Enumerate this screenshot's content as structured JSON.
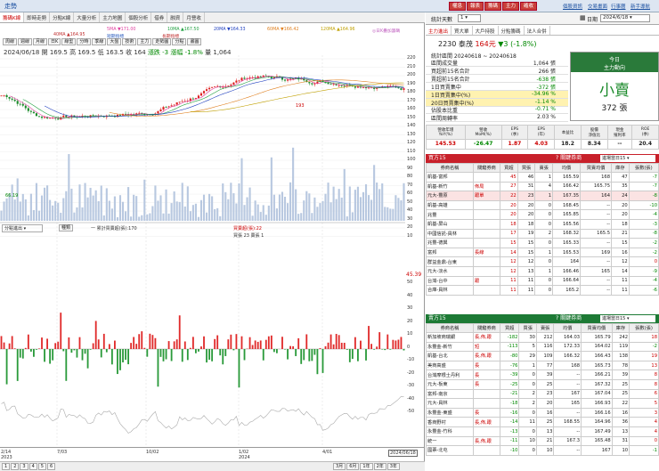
{
  "app": {
    "title": "走勢",
    "buttons": [
      "權息",
      "報表",
      "籌碼",
      "主力",
      "確收"
    ],
    "links": [
      "個股資訊",
      "交易畫面",
      "行事曆",
      "新手導航"
    ]
  },
  "tabs": [
    "籌碼K線",
    "即時走勢",
    "分點K線",
    "大量分析",
    "主力地圖",
    "個股分析",
    "借券",
    "融資",
    "月營收"
  ],
  "ma": {
    "line1": [
      {
        "t": "5MA ▼171.00",
        "c": "#e040a0"
      },
      {
        "t": "10MA ▲167.50",
        "c": "#20a040"
      },
      {
        "t": "20MA ▼164.33",
        "c": "#2040c0"
      },
      {
        "t": "60MA ▼166.42",
        "c": "#e08020"
      },
      {
        "t": "120MA ▲164.96",
        "c": "#c0a000"
      },
      {
        "t": "◎日K疊加籌碼",
        "c": "#c060c0"
      }
    ],
    "line2": [
      {
        "t": "40MA ▲164.95",
        "c": "#c03030"
      },
      {
        "t": "短期指標",
        "c": "#3060c0"
      },
      {
        "t": "長期指標",
        "c": "#c03030"
      }
    ]
  },
  "toolbar": [
    "周線",
    "週線",
    "月線",
    "日K",
    "線型",
    "分時",
    "季線",
    "大盤",
    "技術",
    "主力",
    "走勢圖",
    "分點",
    "畫圖"
  ],
  "info": {
    "date": "2024/06/18",
    "open": "開 169.5",
    "high": "高 169.5",
    "low": "低 163.5",
    "close": "收 164",
    "chg": "漲跌 -3",
    "pct": "漲幅 -1.8%",
    "vol": "量 1,064"
  },
  "yaxis": [
    "220",
    "210",
    "200",
    "190",
    "180",
    "170",
    "160",
    "150",
    "140",
    "130",
    "120",
    "110",
    "100",
    "90",
    "80",
    "70",
    "60",
    "50",
    "40",
    "30",
    "20",
    "10"
  ],
  "price_annot": {
    "hi": "193",
    "lo": "66.19"
  },
  "sub": {
    "select": "分點進出",
    "btn": "種類",
    "legend1": "一 累計買賣超(張):170",
    "legend2": "買賣超(張):22",
    "legend3": "買張 23  賣張 1",
    "last": "45.39",
    "ticks": [
      "50",
      "40",
      "30",
      "20",
      "10",
      "0",
      "-10",
      "-20",
      "-30",
      "-40",
      "-50"
    ]
  },
  "xaxis": [
    "2/14",
    "7/03",
    "10/02",
    "1/02",
    "4/01",
    "2024/06/18"
  ],
  "xaxis_years": [
    "2023",
    "2024"
  ],
  "bottom": {
    "pages": [
      "1",
      "2",
      "3",
      "4",
      "5",
      "6"
    ],
    "ranges": [
      "3月",
      "6月",
      "1年",
      "2年",
      "3年"
    ]
  },
  "right": {
    "header": {
      "label": "統計天數",
      "days": "1",
      "date_label": "日期",
      "date": "2024/6/18"
    },
    "subtabs": [
      "主力進出",
      "買大單",
      "大戶持股",
      "分點籌碼",
      "法人合併"
    ],
    "stock": {
      "code": "2230 泰茂",
      "price": "164元",
      "chg": "▼3 (-1.8%)"
    },
    "range": "統計區間  20240618 ~ 20240618",
    "stats": [
      {
        "k": "區間成交量",
        "v": "1,064 張"
      },
      {
        "k": "買超前15名合計",
        "v": "266 張"
      },
      {
        "k": "賣超前15名合計",
        "v": "-638 張"
      },
      {
        "k": "1日買賣集中",
        "v": "-372 張"
      },
      {
        "k": "1日買賣集中(%)",
        "v": "-34.96 %"
      },
      {
        "k": "20日買賣集中(%)",
        "v": "-1.14 %"
      },
      {
        "k": "佔股本比重",
        "v": "-0.71 %"
      },
      {
        "k": "區間周轉率",
        "v": "2.03 %"
      }
    ],
    "mainforce": {
      "title": "今日",
      "sub": "主力動向",
      "verdict": "小賣",
      "amount": "372 張"
    },
    "fin_head": [
      "營收年增\nYoY(%)",
      "營收\nMoM(%)",
      "EPS\n(季)",
      "EPS\n(年)",
      "本益比",
      "股價\n淨值比",
      "現金\n殖利率",
      "ROE\n(季)"
    ],
    "fin_vals": [
      "145.53",
      "-26.47",
      "1.87",
      "4.03",
      "18.2",
      "8.34",
      "--",
      "20.4"
    ],
    "buy_title": "買方15",
    "sell_title": "賣方15",
    "broker_label": "? 關鍵券商",
    "broker_sel": "進場當日15",
    "cols": [
      "券商名稱",
      "關鍵券商",
      "買超",
      "買張",
      "賣張",
      "均價",
      "買賣均價",
      "庫存",
      "張數(張)"
    ],
    "buy": [
      [
        "凱基-富邦",
        "",
        "45",
        "46",
        "1",
        "165.59",
        "168",
        "47",
        "-7"
      ],
      [
        "凱基-新竹",
        "佈局",
        "27",
        "31",
        "4",
        "166.42",
        "165.75",
        "35",
        "-7"
      ],
      [
        "元大-豐原",
        "跟單",
        "22",
        "23",
        "1",
        "167.35",
        "164",
        "24",
        "-8"
      ],
      [
        "凱基-高雄",
        "",
        "20",
        "20",
        "0",
        "168.45",
        "--",
        "20",
        "-10"
      ],
      [
        "兆豐",
        "",
        "20",
        "20",
        "0",
        "165.85",
        "--",
        "20",
        "-4"
      ],
      [
        "凱基-屏山",
        "",
        "18",
        "18",
        "0",
        "165.56",
        "--",
        "18",
        "-3"
      ],
      [
        "中國信託-員林",
        "",
        "17",
        "19",
        "2",
        "168.32",
        "165.5",
        "21",
        "-8"
      ],
      [
        "兆豐-德興",
        "",
        "15",
        "15",
        "0",
        "165.33",
        "--",
        "15",
        "-2"
      ],
      [
        "富邦",
        "長線",
        "14",
        "15",
        "1",
        "165.53",
        "169",
        "16",
        "-2"
      ],
      [
        "群益金鼎-台東",
        "",
        "12",
        "12",
        "0",
        "164",
        "--",
        "12",
        "0"
      ],
      [
        "元大-淡水",
        "",
        "12",
        "13",
        "1",
        "166.46",
        "165",
        "14",
        "-9"
      ],
      [
        "台灣-台中",
        "跟",
        "11",
        "11",
        "0",
        "166.64",
        "--",
        "11",
        "-4"
      ],
      [
        "合庫-員林",
        "",
        "11",
        "11",
        "0",
        "165.2",
        "--",
        "11",
        "-6"
      ]
    ],
    "sell": [
      [
        "新加坡商瑞銀",
        "長,佈,跟",
        "-182",
        "30",
        "212",
        "164.03",
        "165.79",
        "242",
        "18"
      ],
      [
        "永豐金-新竹",
        "短",
        "-113",
        "5",
        "116",
        "172.33",
        "164.02",
        "119",
        "-2"
      ],
      [
        "凱基-台北",
        "長,佈,跟",
        "-80",
        "29",
        "109",
        "166.32",
        "166.43",
        "138",
        "19"
      ],
      [
        "美商高盛",
        "長",
        "-76",
        "1",
        "77",
        "168",
        "165.73",
        "78",
        "13"
      ],
      [
        "台灣摩根士丹利",
        "長",
        "-39",
        "0",
        "39",
        "--",
        "166.21",
        "39",
        "8"
      ],
      [
        "元大-板東",
        "長",
        "-25",
        "0",
        "25",
        "--",
        "167.32",
        "25",
        "8"
      ],
      [
        "富邦-南京",
        "",
        "-21",
        "2",
        "23",
        "167",
        "167.04",
        "25",
        "6"
      ],
      [
        "元大-員林",
        "",
        "-18",
        "2",
        "20",
        "165",
        "166.93",
        "22",
        "5"
      ],
      [
        "永豐金-東盛",
        "長",
        "-16",
        "0",
        "16",
        "--",
        "166.16",
        "16",
        "3"
      ],
      [
        "香商野村",
        "長,佈,跟",
        "-14",
        "11",
        "25",
        "168.55",
        "164.96",
        "36",
        "4"
      ],
      [
        "永豐金-竹科",
        "",
        "-13",
        "0",
        "13",
        "--",
        "167.49",
        "13",
        "4"
      ],
      [
        "統一",
        "長,佈,跟",
        "-11",
        "10",
        "21",
        "167.3",
        "165.48",
        "31",
        "0"
      ],
      [
        "國票-北屯",
        "",
        "-10",
        "0",
        "10",
        "--",
        "167",
        "10",
        "-1"
      ]
    ]
  }
}
